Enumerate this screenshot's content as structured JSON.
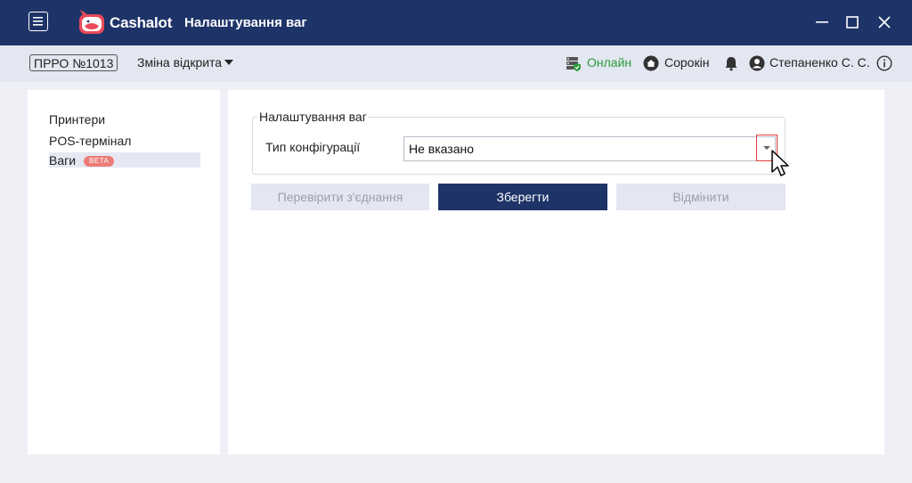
{
  "window": {
    "brand": "Cashalot",
    "title": "Налаштування ваг"
  },
  "toolbar": {
    "prro": "ПРРО №1013",
    "shift_label": "Зміна відкрита",
    "status": "Онлайн",
    "store": "Сорокін",
    "user": "Степаненко С. С."
  },
  "sidebar": {
    "items": [
      {
        "label": "Принтери"
      },
      {
        "label": "POS-термінал"
      },
      {
        "label": "Ваги",
        "badge": "BETA",
        "selected": true
      }
    ]
  },
  "form": {
    "group_title": "Налаштування ваг",
    "config_label": "Тип конфігурації",
    "config_value": "Не вказано",
    "buttons": {
      "test": "Перевірити з'єднання",
      "save": "Зберегти",
      "cancel": "Відмінити"
    }
  },
  "colors": {
    "titlebar": "#1e3468",
    "toolbar": "#e3e7f1",
    "online": "#2a9a3c",
    "beta": "#ec7b76",
    "highlight": "#e23b3b"
  },
  "icons": [
    "menu-icon",
    "cashalot-logo",
    "minimize-icon",
    "maximize-icon",
    "close-icon",
    "server-online-icon",
    "home-icon",
    "bell-icon",
    "user-icon",
    "info-icon",
    "chevron-down-icon"
  ]
}
